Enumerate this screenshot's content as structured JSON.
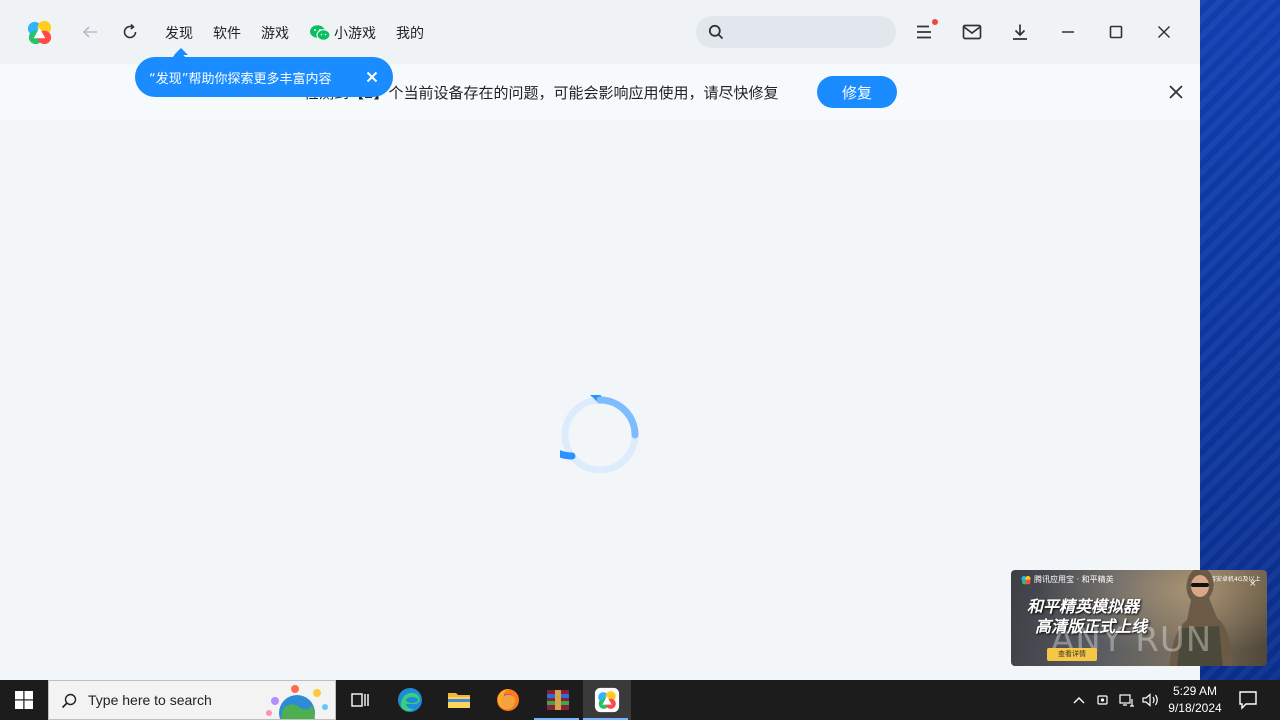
{
  "header": {
    "tabs": [
      {
        "label": "发现",
        "active": true
      },
      {
        "label": "软件"
      },
      {
        "label": "游戏"
      },
      {
        "label": "小游戏"
      },
      {
        "label": "我的"
      }
    ],
    "search": {
      "placeholder": "",
      "value": ""
    },
    "icons": [
      "back-arrow-icon",
      "refresh-icon",
      "search-icon",
      "menu-icon",
      "mail-icon",
      "download-icon",
      "minimize-icon",
      "maximize-icon",
      "close-icon"
    ]
  },
  "tooltip": {
    "text": "“发现”帮助你探索更多丰富内容"
  },
  "banner": {
    "text": "检测到【2】个当前设备存在的问题，可能会影响应用使用，请尽快修复",
    "fix_label": "修复"
  },
  "ad": {
    "brand": "腾讯应用宝 · 和平精英",
    "top_right": "支持安卓机4G及以上",
    "close": "×",
    "title_line1": "和平精英模拟器",
    "title_line2": "高清版正式上线",
    "cta": "查看详情",
    "watermark": "ANY RUN"
  },
  "taskbar": {
    "search_placeholder": "Type here to search",
    "time": "5:29 AM",
    "date": "9/18/2024"
  },
  "colors": {
    "accent": "#1a8cff",
    "window_bg": "#f3f6f9",
    "taskbar": "#1c1c1c"
  }
}
